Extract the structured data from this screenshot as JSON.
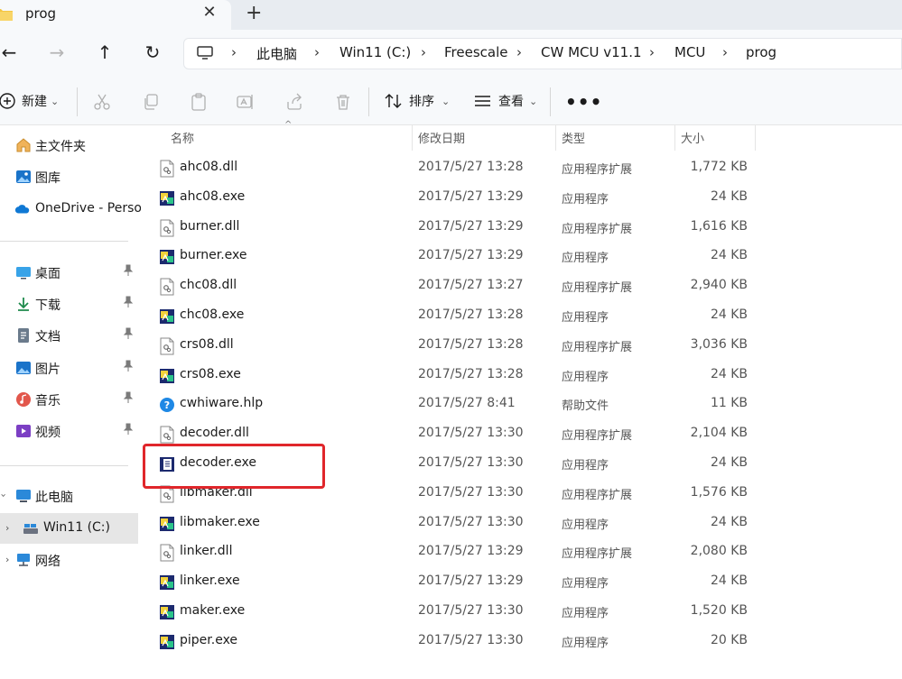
{
  "tab": {
    "title": "prog",
    "close": "✕",
    "new": "+"
  },
  "nav": {
    "back": "←",
    "forward": "→",
    "up": "↑",
    "refresh": "↻"
  },
  "breadcrumb": [
    {
      "label": "此电脑"
    },
    {
      "label": "Win11 (C:)"
    },
    {
      "label": "Freescale"
    },
    {
      "label": "CW MCU v11.1"
    },
    {
      "label": "MCU"
    },
    {
      "label": "prog"
    }
  ],
  "breadcrumb_sep": "›",
  "commands": {
    "new_label": "新建",
    "sort_label": "排序",
    "view_label": "查看",
    "more_label": "•••",
    "dropdown": "⌄"
  },
  "sidebar": {
    "quick": [
      {
        "label": "主文件夹",
        "icon": "home-icon"
      },
      {
        "label": "图库",
        "icon": "gallery-icon"
      },
      {
        "label": "OneDrive - Persor",
        "icon": "onedrive-icon"
      }
    ],
    "pinned": [
      {
        "label": "桌面",
        "icon": "desktop-icon"
      },
      {
        "label": "下载",
        "icon": "download-icon"
      },
      {
        "label": "文档",
        "icon": "document-icon"
      },
      {
        "label": "图片",
        "icon": "pictures-icon"
      },
      {
        "label": "音乐",
        "icon": "music-icon"
      },
      {
        "label": "视频",
        "icon": "video-icon"
      }
    ],
    "tree": [
      {
        "label": "此电脑",
        "icon": "computer-icon"
      },
      {
        "label": "Win11 (C:)",
        "icon": "drive-icon"
      },
      {
        "label": "网络",
        "icon": "network-icon"
      }
    ]
  },
  "columns": {
    "name": "名称",
    "date": "修改日期",
    "type": "类型",
    "size": "大小",
    "sort_indicator": "^"
  },
  "files": [
    {
      "name": "ahc08.dll",
      "date": "2017/5/27 13:28",
      "type": "应用程序扩展",
      "size": "1,772 KB",
      "kind": "dll"
    },
    {
      "name": "ahc08.exe",
      "date": "2017/5/27 13:29",
      "type": "应用程序",
      "size": "24 KB",
      "kind": "exe"
    },
    {
      "name": "burner.dll",
      "date": "2017/5/27 13:29",
      "type": "应用程序扩展",
      "size": "1,616 KB",
      "kind": "dll"
    },
    {
      "name": "burner.exe",
      "date": "2017/5/27 13:29",
      "type": "应用程序",
      "size": "24 KB",
      "kind": "exe"
    },
    {
      "name": "chc08.dll",
      "date": "2017/5/27 13:27",
      "type": "应用程序扩展",
      "size": "2,940 KB",
      "kind": "dll"
    },
    {
      "name": "chc08.exe",
      "date": "2017/5/27 13:28",
      "type": "应用程序",
      "size": "24 KB",
      "kind": "exe"
    },
    {
      "name": "crs08.dll",
      "date": "2017/5/27 13:28",
      "type": "应用程序扩展",
      "size": "3,036 KB",
      "kind": "dll"
    },
    {
      "name": "crs08.exe",
      "date": "2017/5/27 13:28",
      "type": "应用程序",
      "size": "24 KB",
      "kind": "exe"
    },
    {
      "name": "cwhiware.hlp",
      "date": "2017/5/27 8:41",
      "type": "帮助文件",
      "size": "11 KB",
      "kind": "hlp"
    },
    {
      "name": "decoder.dll",
      "date": "2017/5/27 13:30",
      "type": "应用程序扩展",
      "size": "2,104 KB",
      "kind": "dll"
    },
    {
      "name": "decoder.exe",
      "date": "2017/5/27 13:30",
      "type": "应用程序",
      "size": "24 KB",
      "kind": "exe"
    },
    {
      "name": "libmaker.dll",
      "date": "2017/5/27 13:30",
      "type": "应用程序扩展",
      "size": "1,576 KB",
      "kind": "dll"
    },
    {
      "name": "libmaker.exe",
      "date": "2017/5/27 13:30",
      "type": "应用程序",
      "size": "24 KB",
      "kind": "exe"
    },
    {
      "name": "linker.dll",
      "date": "2017/5/27 13:29",
      "type": "应用程序扩展",
      "size": "2,080 KB",
      "kind": "dll"
    },
    {
      "name": "linker.exe",
      "date": "2017/5/27 13:29",
      "type": "应用程序",
      "size": "24 KB",
      "kind": "exe"
    },
    {
      "name": "maker.exe",
      "date": "2017/5/27 13:30",
      "type": "应用程序",
      "size": "1,520 KB",
      "kind": "exe"
    },
    {
      "name": "piper.exe",
      "date": "2017/5/27 13:30",
      "type": "应用程序",
      "size": "20 KB",
      "kind": "exe"
    }
  ],
  "colors": {
    "highlight": "#e0262b",
    "accent": "#0067c0",
    "folder": "#f4c542"
  }
}
